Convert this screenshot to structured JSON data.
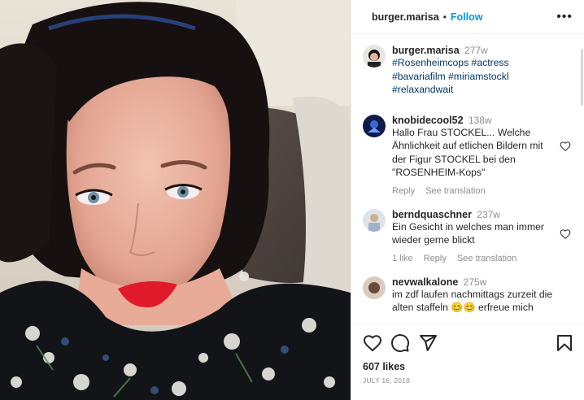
{
  "header": {
    "username": "burger.marisa",
    "separator": "•",
    "follow_label": "Follow",
    "more_label": "•••"
  },
  "caption": {
    "username": "burger.marisa",
    "time": "277w",
    "text": "#Rosenheimcops #actress #bavariafilm #miriamstockl #relaxandwait"
  },
  "comments": [
    {
      "username": "knobidecool52",
      "time": "138w",
      "text": "Hallo Frau STOCKEL... Welche Ähnlichkeit auf etlichen Bildern mit der Figur STOCKEL bei den \"ROSENHEIM-Kops\"",
      "reply_label": "Reply",
      "translation_label": "See translation"
    },
    {
      "username": "berndquaschner",
      "time": "237w",
      "text": "Ein Gesicht in welches man immer wieder gerne blickt",
      "likes_label": "1 like",
      "reply_label": "Reply",
      "translation_label": "See translation"
    },
    {
      "username": "nevwalkalone",
      "time": "275w",
      "text": "im zdf laufen nachmittags zurzeit die alten staffeln 😊😊 erfreue mich"
    }
  ],
  "post": {
    "likes": "607 likes",
    "date": "JULY 16, 2018"
  },
  "icons": {
    "like": "heart-icon",
    "comment": "comment-icon",
    "share": "paper-plane-icon",
    "save": "bookmark-icon",
    "comment_like": "small-heart-icon"
  },
  "colors": {
    "accent": "#0095f6",
    "text": "#262626",
    "muted": "#8e8e8e",
    "hashtag": "#00376b",
    "lips": "#e01a2b"
  }
}
